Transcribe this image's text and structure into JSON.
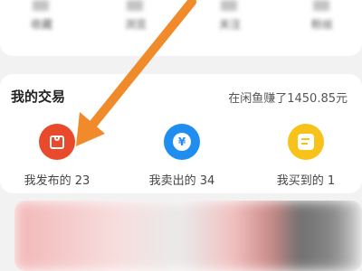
{
  "top_row": {
    "items": [
      {
        "label": "收藏"
      },
      {
        "label": "浏览"
      },
      {
        "label": "关注"
      },
      {
        "label": "粉丝"
      }
    ]
  },
  "trade": {
    "title": "我的交易",
    "earned_text": "在闲鱼赚了1450.85元",
    "items": [
      {
        "label": "我发布的 23",
        "icon": "bag-icon",
        "color": "#ea4a2c"
      },
      {
        "label": "我卖出的 34",
        "icon": "yen-icon",
        "color": "#1f8ef0"
      },
      {
        "label": "我买到的 1",
        "icon": "purchase-icon",
        "color": "#f7c21a"
      }
    ]
  },
  "annotation": {
    "type": "orange-arrow",
    "color": "#f08a2a"
  }
}
